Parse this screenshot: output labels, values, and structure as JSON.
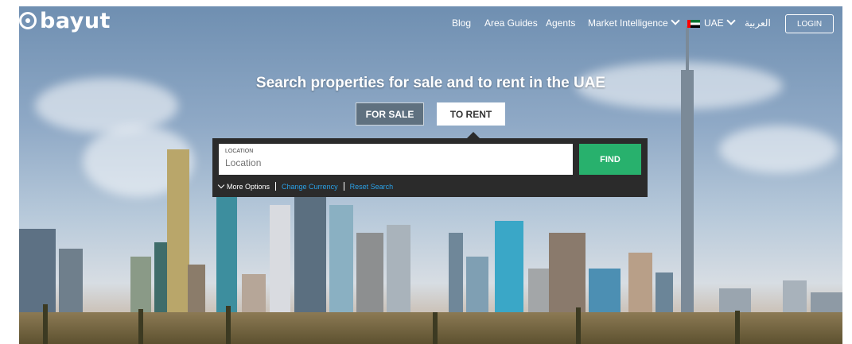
{
  "brand": {
    "name": "bayut"
  },
  "nav": {
    "items": [
      "Blog",
      "Area Guides",
      "Agents",
      "Market Intelligence"
    ],
    "country": "UAE",
    "language": "العربية",
    "login": "LOGIN"
  },
  "hero": {
    "headline": "Search properties for sale and to rent in the UAE",
    "tabs": {
      "sale": "FOR SALE",
      "rent": "TO RENT",
      "active": "TO RENT"
    }
  },
  "search": {
    "location_label": "LOCATION",
    "location_placeholder": "Location",
    "location_value": "",
    "find": "FIND",
    "more_options": "More Options",
    "change_currency": "Change Currency",
    "reset_search": "Reset Search"
  },
  "colors": {
    "accent": "#28b16d",
    "link": "#2aa0e6",
    "panel": "#2b2b2b",
    "tab_inactive": "#5f7180"
  },
  "icons": [
    "logo-mark-icon",
    "chevron-down-icon",
    "uae-flag-icon"
  ]
}
